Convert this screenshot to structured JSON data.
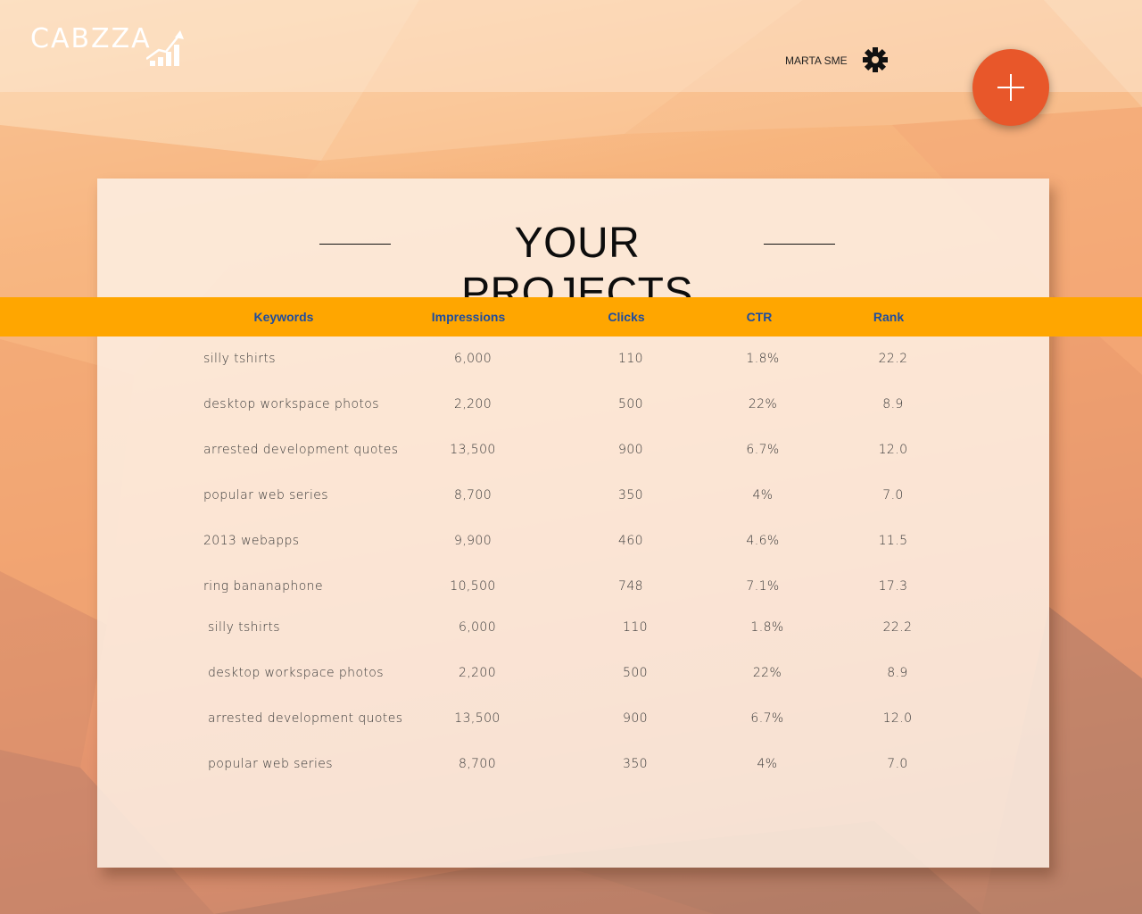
{
  "app": {
    "logo_text": "CABZZA",
    "user_name": "MARTA SME"
  },
  "icons": {
    "settings": "gear-icon",
    "add": "plus-icon",
    "logo": "rising-bar-chart-icon"
  },
  "colors": {
    "accent_orange": "#ffa600",
    "fab": "#e8572a",
    "header_text": "#1f4d9e"
  },
  "page": {
    "title": "YOUR PROJECTS"
  },
  "table": {
    "columns": [
      "Keywords",
      "Impressions",
      "Clicks",
      "CTR",
      "Rank"
    ],
    "rows": [
      [
        "silly tshirts",
        "6,000",
        "110",
        "1.8%",
        "22.2"
      ],
      [
        "desktop workspace photos",
        "2,200",
        "500",
        "22%",
        "8.9"
      ],
      [
        "arrested development quotes",
        "13,500",
        "900",
        "6.7%",
        "12.0"
      ],
      [
        "popular web series",
        "8,700",
        "350",
        "4%",
        "7.0"
      ],
      [
        "2013 webapps",
        "9,900",
        "460",
        "4.6%",
        "11.5"
      ],
      [
        "ring bananaphone",
        "10,500",
        "748",
        "7.1%",
        "17.3"
      ],
      [
        "silly tshirts",
        "6,000",
        "110",
        "1.8%",
        "22.2"
      ],
      [
        "desktop workspace photos",
        "2,200",
        "500",
        "22%",
        "8.9"
      ],
      [
        "arrested development quotes",
        "13,500",
        "900",
        "6.7%",
        "12.0"
      ],
      [
        "popular web series",
        "8,700",
        "350",
        "4%",
        "7.0"
      ]
    ]
  }
}
